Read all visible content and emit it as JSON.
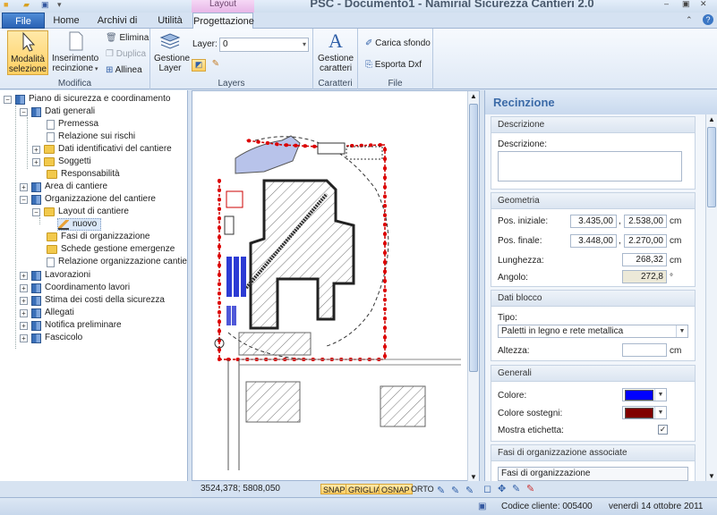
{
  "window": {
    "title": "PSC - Documento1 - Namirial Sicurezza Cantieri 2.0",
    "context_tab": "Layout"
  },
  "tabs": {
    "file": "File",
    "home": "Home",
    "archivi": "Archivi di base",
    "utilita": "Utilità",
    "progettazione": "Progettazione"
  },
  "ribbon": {
    "modifica": {
      "label": "Modifica",
      "modalita": "Modalità selezione",
      "inserimento": "Inserimento recinzione",
      "elimina": "Elimina",
      "duplica": "Duplica",
      "allinea": "Allinea"
    },
    "layers": {
      "label": "Layers",
      "gestione": "Gestione Layer",
      "layer_label": "Layer:",
      "layer_value": "0"
    },
    "caratteri": {
      "label": "Caratteri",
      "gestione": "Gestione caratteri"
    },
    "file": {
      "label": "File",
      "carica": "Carica sfondo",
      "esporta": "Esporta Dxf"
    }
  },
  "tree": {
    "root": "Piano di sicurezza e coordinamento",
    "dati_generali": "Dati generali",
    "premessa": "Premessa",
    "relazione_rischi": "Relazione sui rischi",
    "dati_identificativi": "Dati identificativi del cantiere",
    "soggetti": "Soggetti",
    "responsabilita": "Responsabilità",
    "area": "Area di cantiere",
    "organizzazione": "Organizzazione del cantiere",
    "layout": "Layout di cantiere",
    "nuovo": "nuovo",
    "fasi": "Fasi di organizzazione",
    "schede": "Schede gestione emergenze",
    "relazione_org": "Relazione organizzazione cantiere",
    "lavorazioni": "Lavorazioni",
    "coordinamento": "Coordinamento lavori",
    "stima": "Stima dei costi della sicurezza",
    "allegati": "Allegati",
    "notifica": "Notifica preliminare",
    "fascicolo": "Fascicolo"
  },
  "canvas_status": {
    "coords": "3524,378; 5808,050",
    "snap": "SNAP",
    "griglia": "GRIGLIA",
    "osnap": "OSNAP",
    "orto": "ORTO"
  },
  "props": {
    "title": "Recinzione",
    "descrizione": {
      "header": "Descrizione",
      "label": "Descrizione:"
    },
    "geometria": {
      "header": "Geometria",
      "pos_iniziale": "Pos. iniziale:",
      "pos_iniziale_x": "3.435,00",
      "pos_iniziale_y": "2.538,00",
      "pos_finale": "Pos. finale:",
      "pos_finale_x": "3.448,00",
      "pos_finale_y": "2.270,00",
      "lunghezza": "Lunghezza:",
      "lunghezza_val": "268,32",
      "angolo": "Angolo:",
      "angolo_val": "272,8",
      "unit_cm": "cm",
      "unit_deg": "°",
      "sep": ","
    },
    "dati_blocco": {
      "header": "Dati blocco",
      "tipo": "Tipo:",
      "tipo_val": "Paletti in legno e rete metallica",
      "altezza": "Altezza:"
    },
    "generali": {
      "header": "Generali",
      "colore": "Colore:",
      "colore_hex": "#0000ff",
      "colore_sostegni": "Colore sostegni:",
      "colore_sostegni_hex": "#800000",
      "mostra_etichetta": "Mostra etichetta:",
      "mostra_checked": true
    },
    "fasi": {
      "header": "Fasi di organizzazione associate",
      "col": "Fasi di organizzazione"
    }
  },
  "statusbar": {
    "codice": "Codice cliente: 005400",
    "data": "venerdì 14 ottobre 2011"
  }
}
